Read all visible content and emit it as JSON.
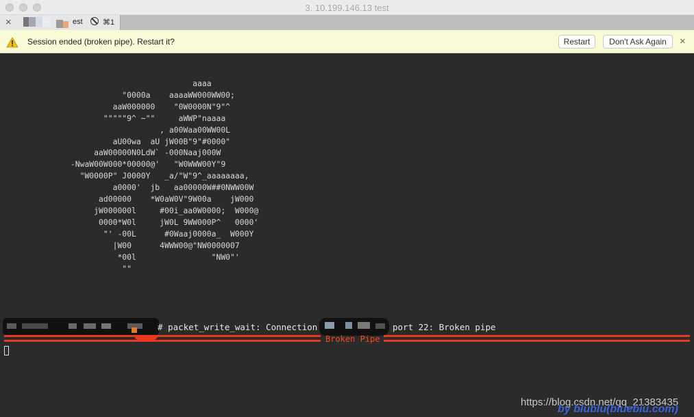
{
  "window": {
    "title": "3. 10.199.146.13 test"
  },
  "tab": {
    "label": "est",
    "shortcut": "⌘1",
    "close_glyph": "×",
    "icons": [
      "close-icon",
      "no-entry-icon"
    ]
  },
  "notification": {
    "message": "Session ended (broken pipe). Restart it?",
    "restart_label": "Restart",
    "dont_ask_label": "Don't Ask Again",
    "close_glyph": "×",
    "warning_color": "#f2c20a"
  },
  "terminal": {
    "ascii_art": "                                         aaaa\n                          \"0000a    aaaaWW000WW00;\n                        aaW000000    \"0W0000N\"9\"^\n                      \"\"\"\"\"9^ ~\"\"     aWWP\"naaaa\n                                  , a00Waa00WW00L\n                        aU00wa  aU jW00B\"9\"#0000\"\n                    aaW00000N0LdW` -000Naaj000W\n               -NwaW00W000*00000@'   \"W0WWW00Y\"9\n                 \"W0000P\" J0000Y   _a/\"W\"9^_aaaaaaaa,\n                        a0000'  jb   aa00000W##0NWW00W\n                     ad00000    *W0aW0V\"9W00a    jW000\n                    jW000000l     #00i_aa0W0000;  W000@\n                     0000*W0l     jW0L 9WW000P^   0000'\n                      \"' -00L      #0Waaj0000a_  W000Y\n                        |W00      4WWW00@\"NW0000007\n                         *00l                \"NW0\"'\n                          \"\"",
    "prompt_suffix": "# packet_write_wait: Connection to",
    "port_text": "port 22: Broken pipe",
    "annotation_label": "Broken Pipe",
    "annotation_color": "#e6391d"
  },
  "watermark": {
    "url": "https://blog.csdn.net/qq_21383435",
    "signature": "by blublu(bluebiu.com)"
  }
}
